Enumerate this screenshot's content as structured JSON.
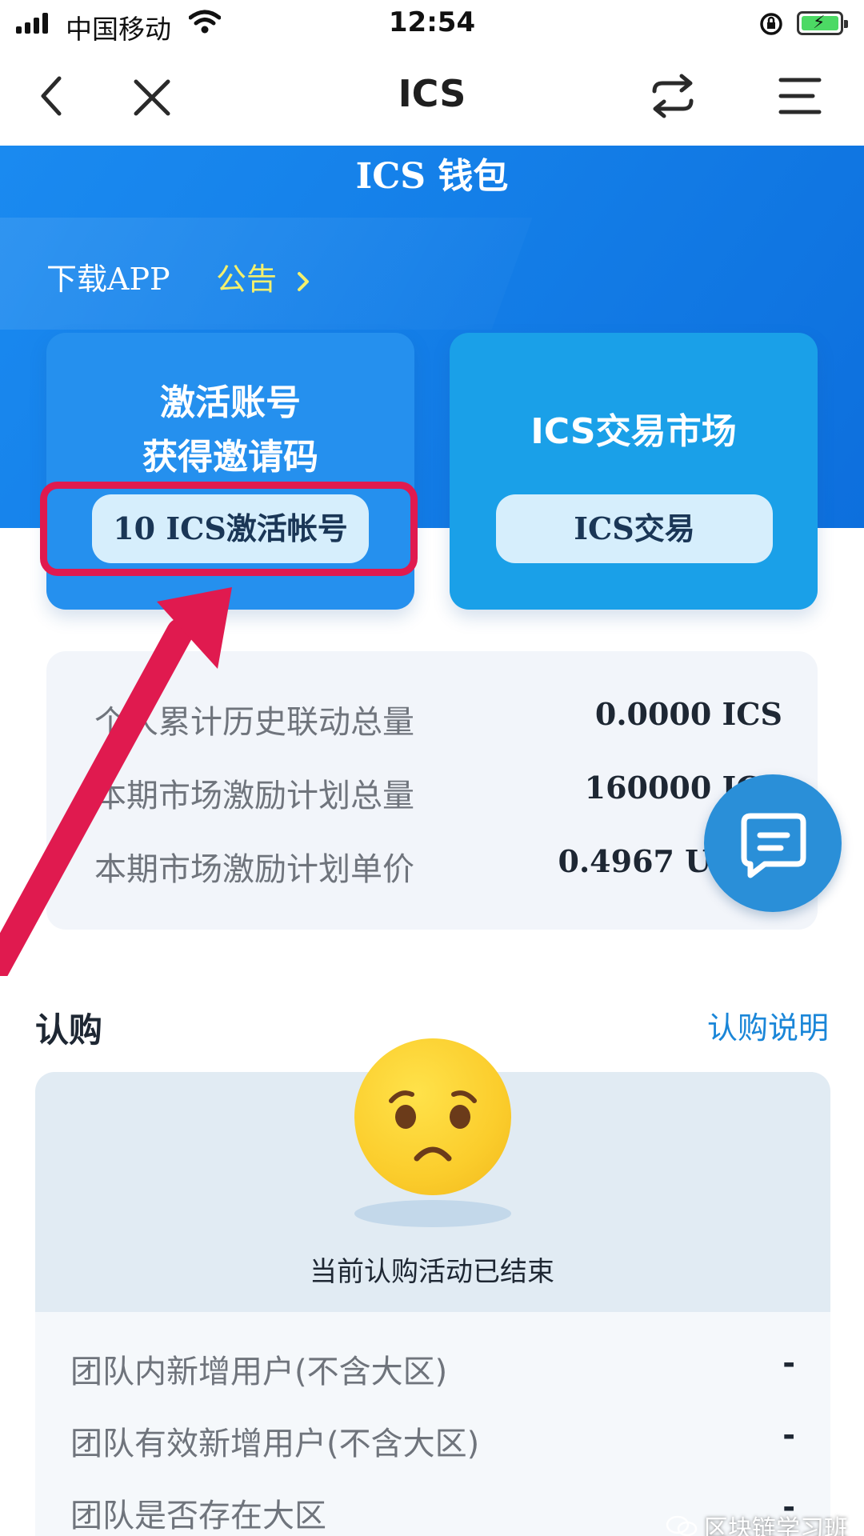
{
  "status_bar": {
    "carrier": "中国移动",
    "time": "12:54"
  },
  "navbar": {
    "title": "ICS",
    "icons": [
      "back-icon",
      "close-icon",
      "switch-icon",
      "menu-icon"
    ]
  },
  "header": {
    "title": "ICS 钱包",
    "download_link": "下载APP",
    "notice_link": "公告"
  },
  "cards": {
    "activate": {
      "line1": "激活账号",
      "line2": "获得邀请码",
      "button": "10 ICS激活帐号"
    },
    "market": {
      "title": "ICS交易市场",
      "button": "ICS交易"
    }
  },
  "stats": [
    {
      "label": "个人累计历史联动总量",
      "value": "0.0000 ICS"
    },
    {
      "label": "本期市场激励计划总量",
      "value": "160000 ICS"
    },
    {
      "label": "本期市场激励计划单价",
      "value": "0.4967 USDT"
    }
  ],
  "subscribe": {
    "title": "认购",
    "help_link": "认购说明",
    "ended_text": "当前认购活动已结束",
    "rows": [
      {
        "label": "团队内新增用户(不含大区)",
        "value": "-"
      },
      {
        "label": "团队有效新增用户(不含大区)",
        "value": "-"
      },
      {
        "label": "团队是否存在大区",
        "value": "-"
      }
    ]
  },
  "watermark": "区块链学习班",
  "colors": {
    "primary_blue": "#147fe8",
    "highlight_red": "#e01a4f",
    "notice_yellow": "#f4f06c"
  }
}
